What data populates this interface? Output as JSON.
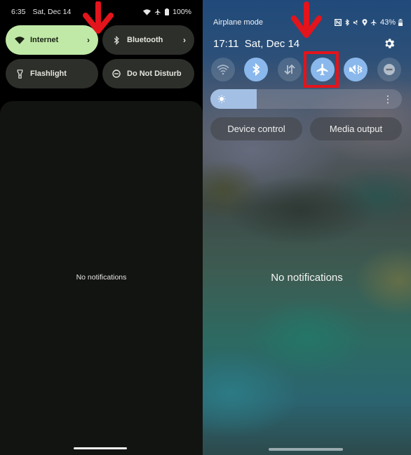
{
  "left_panel": {
    "status_bar": {
      "time": "6:35",
      "date": "Sat, Dec 14",
      "icons": [
        "wifi-icon",
        "airplane-icon",
        "battery-icon"
      ],
      "battery": "100%"
    },
    "tiles": [
      {
        "label": "Internet",
        "icon": "wifi-icon",
        "active": true,
        "has_chevron": true
      },
      {
        "label": "Bluetooth",
        "icon": "bluetooth-icon",
        "active": false,
        "has_chevron": true
      },
      {
        "label": "Flashlight",
        "icon": "flashlight-icon",
        "active": false,
        "has_chevron": false
      },
      {
        "label": "Do Not Disturb",
        "icon": "do-not-disturb-icon",
        "active": false,
        "has_chevron": false
      }
    ],
    "chevron": "›",
    "empty_message": "No notifications",
    "colors": {
      "active_tile": "#c0e9a8",
      "inactive_tile": "#2d2f2b",
      "sheet": "#121411"
    }
  },
  "right_panel": {
    "status_bar": {
      "label": "Airplane mode",
      "icons": [
        "nfc-icon",
        "bluetooth-icon",
        "mute-icon",
        "location-icon",
        "airplane-icon"
      ],
      "battery": "43%"
    },
    "datetime": "17:11  Sat, Dec 14",
    "quick_toggles": [
      {
        "name": "wifi",
        "icon": "wifi-icon",
        "active": false
      },
      {
        "name": "bluetooth",
        "icon": "bluetooth-icon",
        "active": true
      },
      {
        "name": "mobile-data",
        "icon": "data-transfer-icon",
        "active": false
      },
      {
        "name": "airplane-mode",
        "icon": "airplane-icon",
        "active": true,
        "highlighted": true
      },
      {
        "name": "sound-mute",
        "icon": "mute-vibrate-icon",
        "active": true
      },
      {
        "name": "do-not-disturb",
        "icon": "do-not-disturb-icon",
        "active": false
      }
    ],
    "brightness": {
      "value_percent": 24,
      "more_icon": "⋮"
    },
    "buttons": [
      "Device control",
      "Media output"
    ],
    "empty_message": "No notifications",
    "colors": {
      "active_toggle": "#8ab8ec",
      "highlight": "#e3141b"
    }
  },
  "annotations": {
    "arrow_color": "#e3141b"
  }
}
